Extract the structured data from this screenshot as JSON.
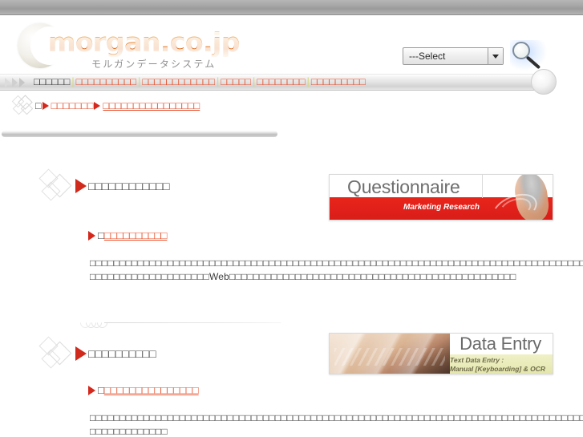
{
  "site": {
    "logo_text": "morgan.co.jp",
    "logo_subtitle": "モルガンデータシステム"
  },
  "header": {
    "select_value": "---Select",
    "search_icon_name": "search-icon"
  },
  "nav": {
    "items": [
      "□□□□□□",
      "□□□□□□□□□□",
      "□□□□□□□□□□□□",
      "□□□□□",
      "□□□□□□□□",
      "□□□□□□□□□"
    ]
  },
  "breadcrumb": {
    "home": "□",
    "level1": "□□□□□□□",
    "current": "□□□□□□□□□□□□□□□□"
  },
  "sections": [
    {
      "title": "□□□□□□□□□□□□",
      "sub_lead": "□",
      "sub_link": "□□□□□□□□□□",
      "body": "□□□□□□□□□□□□□□□□□□□□□□□□□□□□□□□□□□□□□□□□□□□□□□□□□□□□□□□□□□□□□□□□□□□□□□□□□□□□□□□□□□□□□□□□□□□□□□□□□□□□□□□□□□□□□□□□□□□□□□□□□□□□□□□□□□□□□□□□□□□□□□□□□□□□□□□□□□□□□□□□□□□□□□□□□□□□□□□□□□□□□□□□□□□□□□□□□□□□□□□□□□□ □□□□□□□□□□□□□□□□□□□□Web□□□□□□□□□□□□□□□□□□□□□□□□□□□□□□□□□□□□□□□□□□□□□□□□",
      "banner": {
        "name": "questionnaire-banner",
        "title": "Questionnaire",
        "subtitle": "Marketing Research"
      }
    },
    {
      "title": "□□□□□□□□□□",
      "sub_lead": "□",
      "sub_link": "□□□□□□□□□□□□□□□",
      "body": "□□□□□□□□□□□□□□□□□□□□□□□□□□□□□□□□□□□□□□□□□□□□□□□□□□□□□□□□□□□□□□□□□□□□□□□□□□□□□□□□□□□□□□□□□□□□□□□□□□□□□□□□□□□OCR□□□□□□□□□□□□□□□□□□□□□□□□□□□□□□□□□□□□□□□□□□□□□□web □□□□□□□□□□□□□",
      "banner": {
        "name": "data-entry-banner",
        "title": "Data Entry",
        "subtitle_line1": "Text Data Entry :",
        "subtitle_line2": "Manual [Keyboarding] & OCR"
      }
    }
  ],
  "colors": {
    "accent_red": "#d4281c",
    "link_orange": "#e8502c",
    "banner_red": "#e8251a",
    "banner_yellow": "#e9ebb8",
    "text_dark": "#3c3c3c"
  }
}
